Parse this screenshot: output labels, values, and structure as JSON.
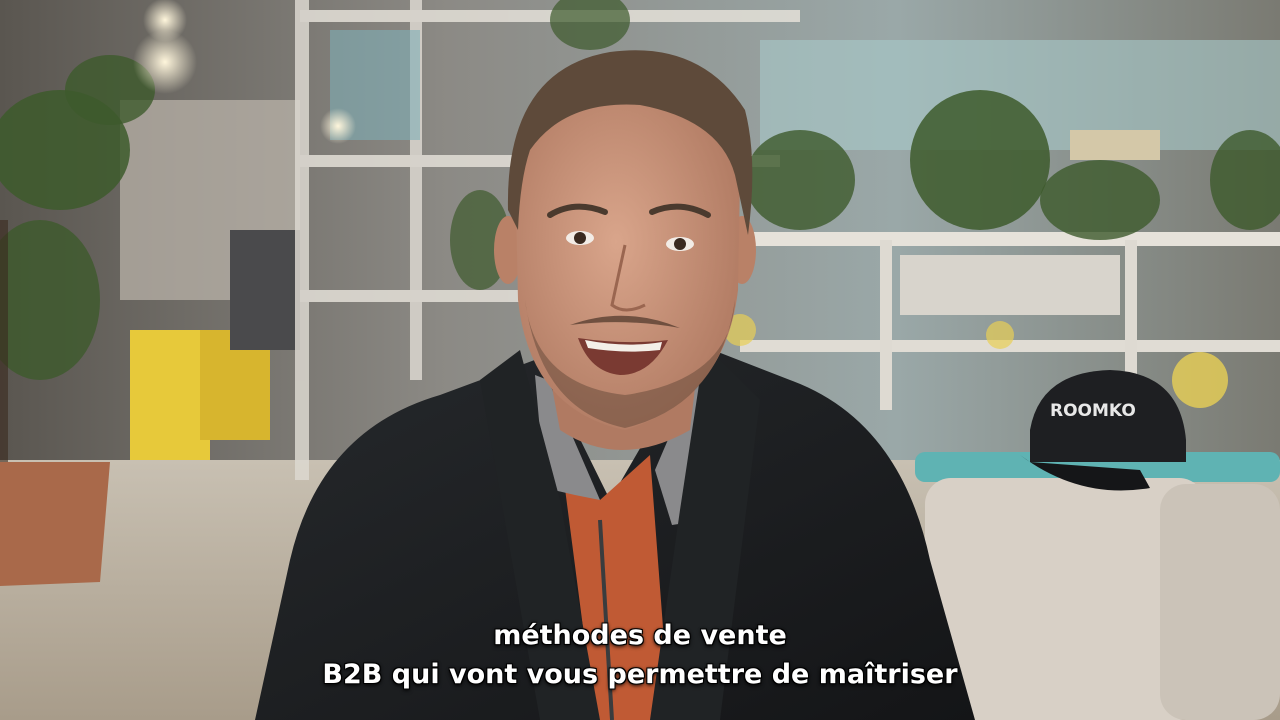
{
  "video": {
    "subtitle_lines": [
      "méthodes de vente",
      "B2B qui vont vous permettre de maîtriser"
    ]
  },
  "scene": {
    "cap_logo_text": "ROOMKO",
    "colors": {
      "jacket": "#1c1e20",
      "skin": "#c9937a",
      "sofa": "#d8d0c6",
      "cushion": "#5fb3b3",
      "pot": "#a9694a",
      "yellow_bin": "#e7c93a"
    }
  }
}
